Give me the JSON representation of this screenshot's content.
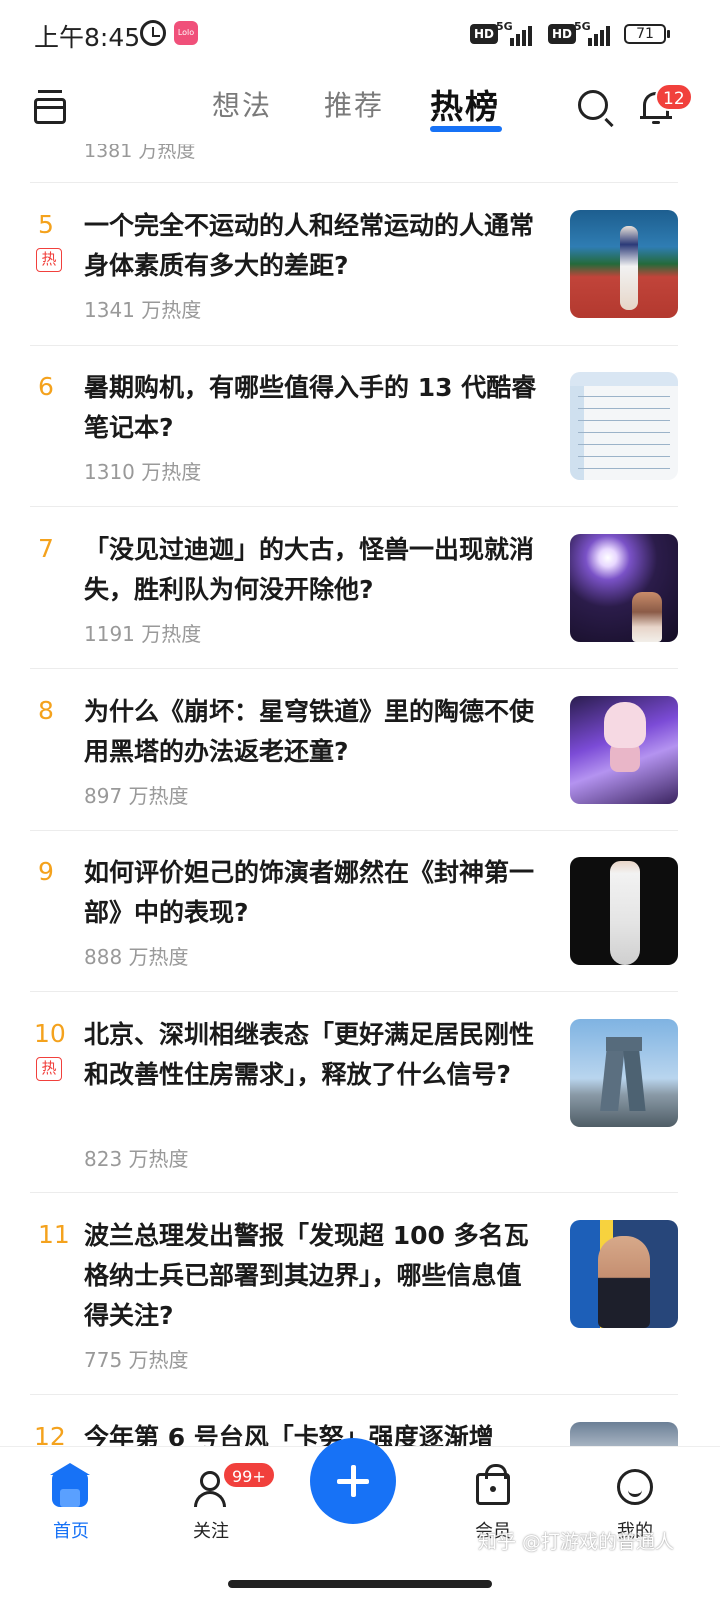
{
  "status_bar": {
    "time": "上午8:45",
    "app_badge_text": "Lolo",
    "hd_1": "HD",
    "net_1": "5G",
    "hd_2": "HD",
    "net_2": "5G",
    "battery": "71"
  },
  "top_nav": {
    "tabs": [
      {
        "label": "想法"
      },
      {
        "label": "推荐"
      },
      {
        "label": "热榜"
      }
    ],
    "active_tab": "热榜",
    "notification_count": "12",
    "accent_color": "#1772f6"
  },
  "feed": {
    "partial_item_heat": "1381 万热度",
    "items": [
      {
        "rank": "5",
        "hot_tag": "热",
        "title": "一个完全不运动的人和经常运动的人通常身体素质有多大的差距?",
        "heat": "1341 万热度"
      },
      {
        "rank": "6",
        "hot_tag": "",
        "title": "暑期购机，有哪些值得入手的 13 代酷睿笔记本?",
        "heat": "1310 万热度"
      },
      {
        "rank": "7",
        "hot_tag": "",
        "title": "「没见过迪迦」的大古，怪兽一出现就消失，胜利队为何没开除他?",
        "heat": "1191 万热度"
      },
      {
        "rank": "8",
        "hot_tag": "",
        "title": "为什么《崩坏：星穹铁道》里的陶德不使用黑塔的办法返老还童?",
        "heat": "897 万热度"
      },
      {
        "rank": "9",
        "hot_tag": "",
        "title": "如何评价妲己的饰演者娜然在《封神第一部》中的表现?",
        "heat": "888 万热度"
      },
      {
        "rank": "10",
        "hot_tag": "热",
        "title": "北京、深圳相继表态「更好满足居民刚性和改善性住房需求」，释放了什么信号?",
        "heat": "823 万热度"
      },
      {
        "rank": "11",
        "hot_tag": "",
        "title": "波兰总理发出警报「发现超 100 多名瓦格纳士兵已部署到其边界」，哪些信息值得关注?",
        "heat": "775 万热度"
      },
      {
        "rank": "12",
        "hot_tag": "",
        "title": "今年第 6 号台风「卡努」强度逐渐增",
        "heat": ""
      }
    ],
    "rank_color": "#f4a21d",
    "hot_tag_color": "#f1403c"
  },
  "bottom_nav": {
    "items": [
      {
        "label": "首页"
      },
      {
        "label": "关注"
      },
      {
        "label": ""
      },
      {
        "label": "会员"
      },
      {
        "label": "我的"
      }
    ],
    "follow_badge": "99+"
  },
  "watermark": "知乎 @打游戏的普通人"
}
